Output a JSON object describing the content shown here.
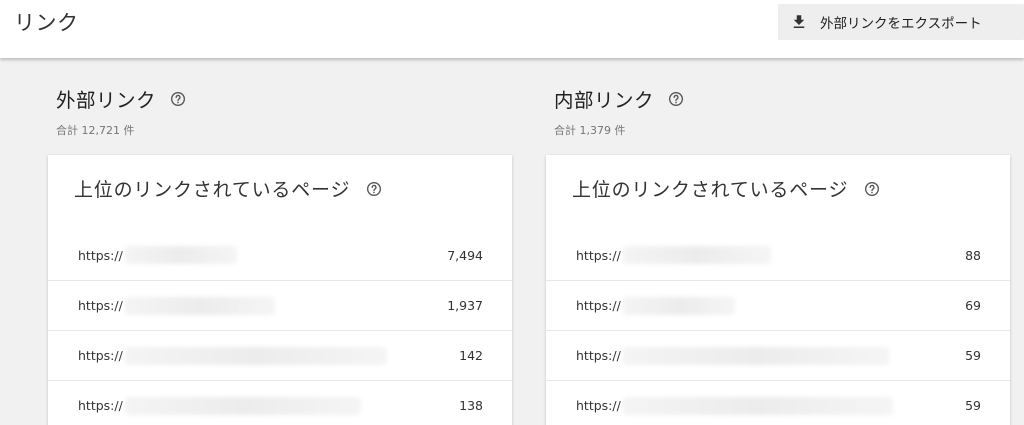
{
  "header": {
    "title": "リンク",
    "export_label": "外部リンクをエクスポート",
    "export_icon": "download-icon"
  },
  "external": {
    "title": "外部リンク",
    "total": "合計 12,721 件",
    "card": {
      "title": "上位のリンクされているページ",
      "rows": [
        {
          "url": "https://",
          "count": "7,494"
        },
        {
          "url": "https://",
          "count": "1,937"
        },
        {
          "url": "https://",
          "count": "142"
        },
        {
          "url": "https://",
          "count": "138"
        }
      ]
    }
  },
  "internal": {
    "title": "内部リンク",
    "total": "合計 1,379 件",
    "card": {
      "title": "上位のリンクされているページ",
      "rows": [
        {
          "url": "https://",
          "count": "88"
        },
        {
          "url": "https://",
          "count": "69"
        },
        {
          "url": "https://",
          "count": "59"
        },
        {
          "url": "https://",
          "count": "59"
        }
      ]
    }
  },
  "colors": {
    "background": "#f1f1f1",
    "card": "#ffffff",
    "text": "#212121",
    "muted": "#757575"
  }
}
